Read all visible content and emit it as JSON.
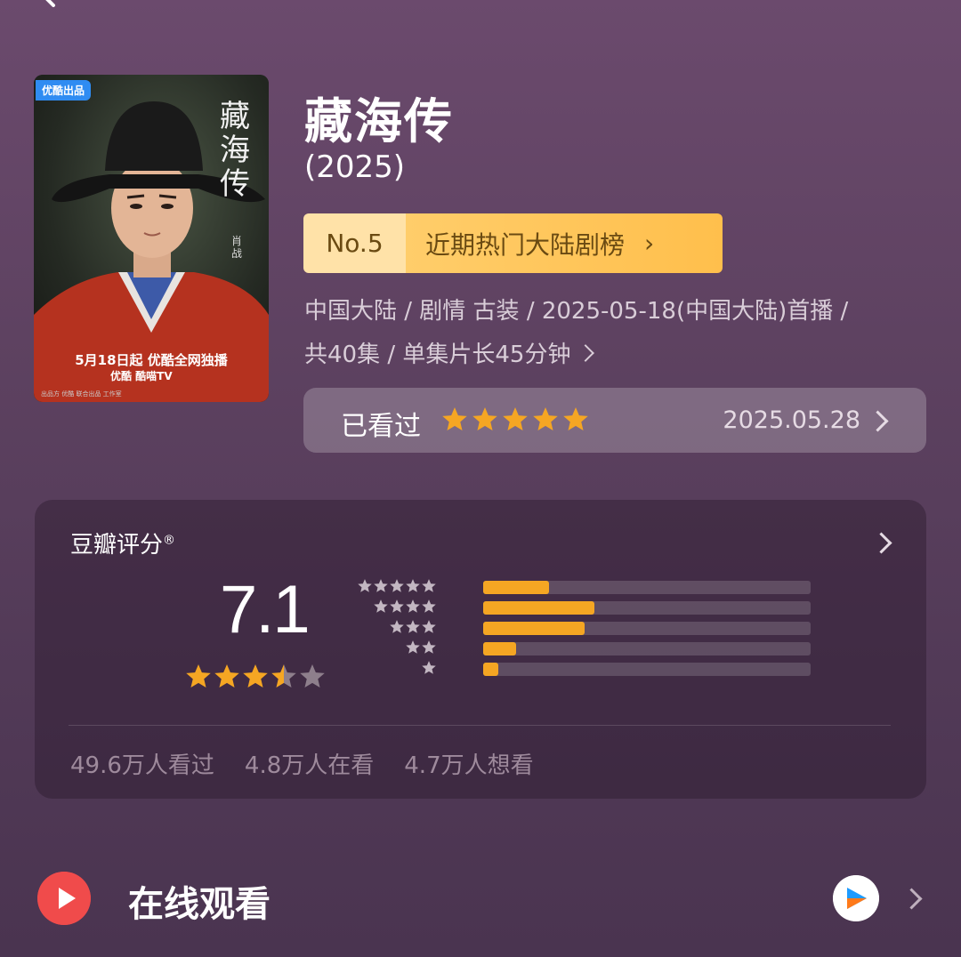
{
  "nav": {
    "back_icon": "chevron-left-icon"
  },
  "poster": {
    "badge": "优酷出品",
    "title": "藏海传",
    "actor": "肖战",
    "release_line": "5月18日起 优酷全网独播",
    "platforms": "优酷  酷喵TV",
    "credits": "出品方  优酷   联合出品   工作室"
  },
  "show": {
    "title": "藏海传",
    "year": "(2025)",
    "rank_no": "No.5",
    "rank_label": "近期热门大陆剧榜",
    "meta_line1": "中国大陆 / 剧情 古装 / 2025-05-18(中国大陆)首播 /",
    "meta_line2": "共40集 / 单集片长45分钟"
  },
  "watched": {
    "label": "已看过",
    "my_stars": 5,
    "date": "2025.05.28"
  },
  "rating": {
    "title": "豆瓣评分",
    "reg": "®",
    "score": "7.1",
    "score_stars": 3.5,
    "distribution": [
      {
        "stars": 5,
        "fraction": 0.2
      },
      {
        "stars": 4,
        "fraction": 0.34
      },
      {
        "stars": 3,
        "fraction": 0.31
      },
      {
        "stars": 2,
        "fraction": 0.1
      },
      {
        "stars": 1,
        "fraction": 0.045
      }
    ],
    "watched_count": "49.6万人看过",
    "watching_count": "4.8万人在看",
    "want_count": "4.7万人想看"
  },
  "online": {
    "label": "在线观看",
    "play_icon": "play-icon",
    "provider_icon": "youku-icon"
  },
  "colors": {
    "accent_star": "#f5a623",
    "rank_bg": "#ffc65a",
    "play_red": "#f04b4b"
  }
}
